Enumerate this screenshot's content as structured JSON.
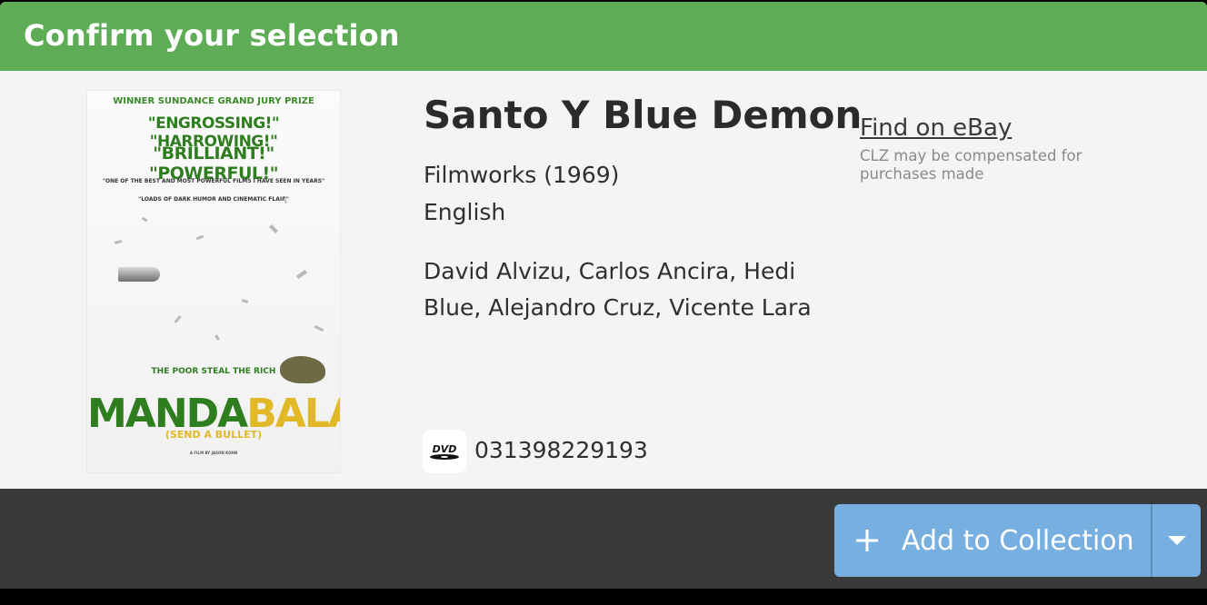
{
  "header": {
    "title": "Confirm your selection"
  },
  "cover": {
    "prize": "WINNER SUNDANCE GRAND JURY PRIZE",
    "quote1": "\"ENGROSSING!\" \"HARROWING!\"",
    "quote2": "\"BRILLIANT!\" \"POWERFUL!\"",
    "small1": "\"ONE OF THE BEST AND MOST POWERFUL FILMS I HAVE SEEN IN YEARS\"",
    "small2": "\"LOADS OF DARK HUMOR AND CINEMATIC FLAIR\"",
    "tagline": "THE POOR STEAL THE RICH",
    "title_part1": "MANDA",
    "title_part2": "BALA",
    "subtitle": "(SEND A BULLET)",
    "credits": "A FILM BY JASON KOHN"
  },
  "movie": {
    "title": "Santo Y Blue Demon",
    "publisher": "Filmworks (1969)",
    "language": "English",
    "cast": "David Alvizu, Carlos Ancira, Hedi Blue, Alejandro Cruz, Vicente Lara",
    "format_icon": "dvd-icon",
    "barcode": "031398229193"
  },
  "ebay": {
    "link_label": "Find on eBay",
    "note": "CLZ may be compensated for purchases made"
  },
  "footer": {
    "add_label": "Add to Collection",
    "plus_icon": "plus-icon",
    "dropdown_icon": "caret-down-icon",
    "button_color": "#76afe0"
  },
  "colors": {
    "header": "#5fac57",
    "footer": "#3a3a3a",
    "panel": "#f4f4f4"
  }
}
